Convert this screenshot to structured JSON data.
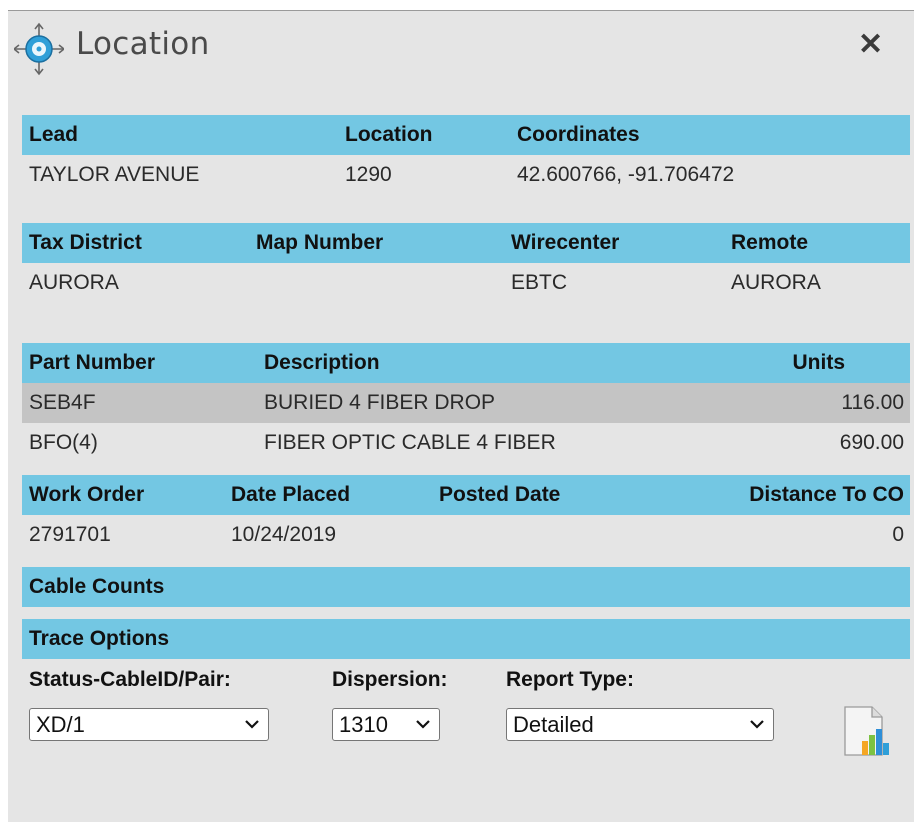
{
  "dialog": {
    "title": "Location",
    "close_label": "✕"
  },
  "lead_section": {
    "headers": {
      "lead": "Lead",
      "location": "Location",
      "coordinates": "Coordinates"
    },
    "values": {
      "lead": "TAYLOR AVENUE",
      "location": "1290",
      "coordinates": "42.600766, -91.706472"
    }
  },
  "district_section": {
    "headers": {
      "tax_district": "Tax District",
      "map_number": "Map Number",
      "wirecenter": "Wirecenter",
      "remote": "Remote"
    },
    "values": {
      "tax_district": "AURORA",
      "map_number": "",
      "wirecenter": "EBTC",
      "remote": "AURORA"
    }
  },
  "parts_section": {
    "headers": {
      "part_number": "Part Number",
      "description": "Description",
      "units": "Units"
    },
    "rows": [
      {
        "part_number": "SEB4F",
        "description": "BURIED 4 FIBER DROP",
        "units": "116.00",
        "selected": true
      },
      {
        "part_number": "BFO(4)",
        "description": "FIBER OPTIC CABLE 4 FIBER",
        "units": "690.00",
        "selected": false
      }
    ]
  },
  "work_order_section": {
    "headers": {
      "work_order": "Work Order",
      "date_placed": "Date Placed",
      "posted_date": "Posted Date",
      "distance": "Distance To CO"
    },
    "values": {
      "work_order": "2791701",
      "date_placed": "10/24/2019",
      "posted_date": "",
      "distance": "0"
    }
  },
  "cable_counts": {
    "title": "Cable Counts"
  },
  "trace_options": {
    "title": "Trace Options",
    "status_label": "Status-CableID/Pair:",
    "status_value": "XD/1",
    "dispersion_label": "Dispersion:",
    "dispersion_value": "1310",
    "report_type_label": "Report Type:",
    "report_type_value": "Detailed"
  },
  "colors": {
    "header_bg": "#73c7e3",
    "selected_row_bg": "#c4c4c4",
    "panel_bg": "#e5e5e5"
  },
  "icons": {
    "title": "location-crosshair-icon",
    "close": "close-icon",
    "report": "report-chart-icon",
    "select": "chevron-down-icon"
  }
}
